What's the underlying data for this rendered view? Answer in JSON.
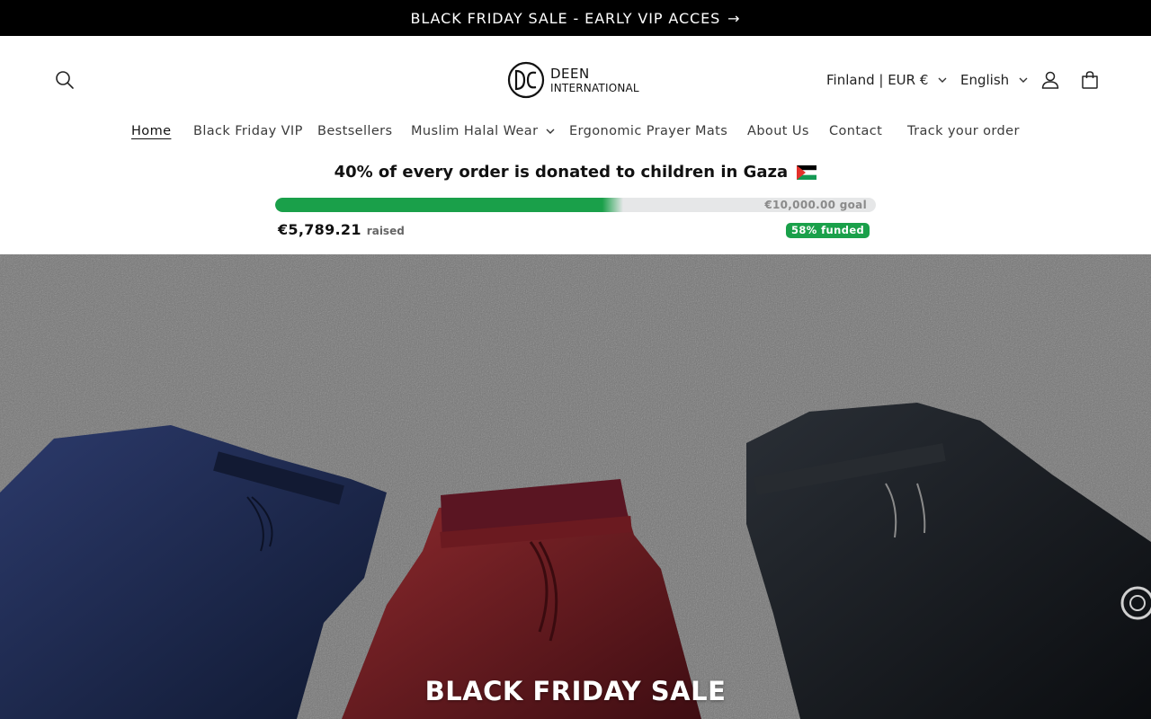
{
  "announcement": {
    "text": "BLACK FRIDAY SALE - EARLY VIP ACCES",
    "arrow": "→"
  },
  "header": {
    "logo": {
      "line1": "DEEN",
      "line2": "INTERNATIONAL"
    },
    "country_selector": "Finland | EUR €",
    "language_selector": "English",
    "icons": [
      "search-icon",
      "account-icon",
      "cart-icon"
    ]
  },
  "nav": {
    "items": [
      {
        "label": "Home",
        "active": true
      },
      {
        "label": "Black Friday VIP"
      },
      {
        "label": "Bestsellers"
      },
      {
        "label": "Muslim Halal Wear",
        "dropdown": true
      },
      {
        "label": "Ergonomic Prayer Mats"
      },
      {
        "label": "About Us"
      },
      {
        "label": "Contact"
      },
      {
        "label": "Track your order"
      }
    ]
  },
  "donation": {
    "title": "40% of every order is donated to children in Gaza",
    "goal": "€10,000.00 goal",
    "raised_amount": "€5,789.21",
    "raised_label": "raised",
    "funded_badge": "58% funded",
    "progress_fraction": 0.58
  },
  "hero": {
    "title": "BLACK FRIDAY SALE"
  },
  "colors": {
    "announcement_bg": "#000000",
    "progress_green": "#1aa04a",
    "progress_track": "#e6e7e8"
  }
}
